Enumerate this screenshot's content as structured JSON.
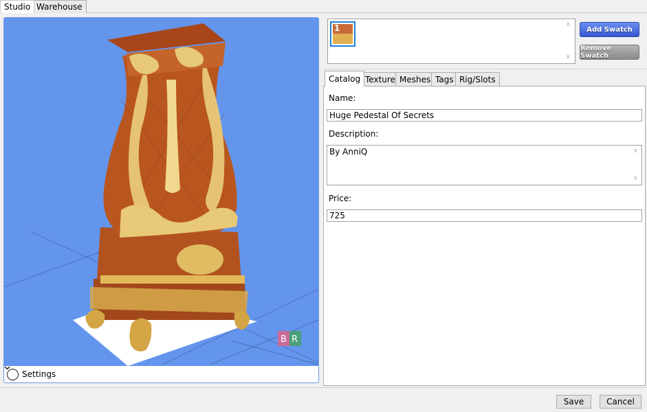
{
  "top_tabs": [
    "Studio",
    "Warehouse"
  ],
  "viewport": {
    "settings_label": "Settings",
    "logo_letters": [
      "B",
      "R"
    ]
  },
  "swatches": {
    "items": [
      {
        "number": "1",
        "colors": [
          "#c96a3a",
          "#e0b055"
        ]
      }
    ],
    "add_label": "Add Swatch",
    "remove_label": "Remove Swatch"
  },
  "inner_tabs": [
    "Catalog",
    "Texture",
    "Meshes",
    "Tags",
    "Rig/Slots"
  ],
  "catalog": {
    "name_label": "Name:",
    "name_value": "Huge Pedestal Of Secrets",
    "description_label": "Description:",
    "description_value": "By AnniQ",
    "price_label": "Price:",
    "price_value": "725"
  },
  "footer": {
    "save_label": "Save",
    "cancel_label": "Cancel"
  },
  "colors": {
    "viewport_bg": "#6495ed",
    "accent_blue": "#3658d0"
  }
}
